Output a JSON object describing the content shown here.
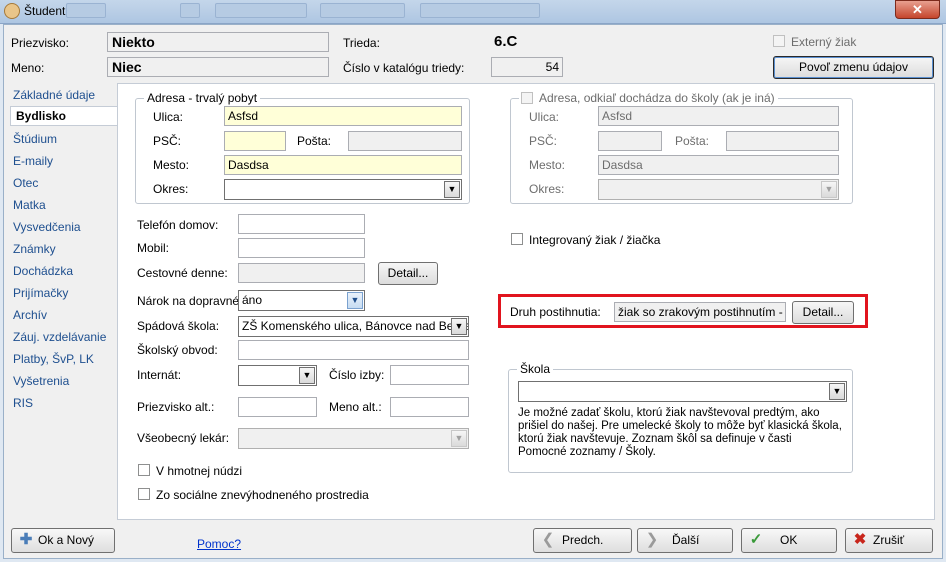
{
  "window": {
    "title": "Študent",
    "close_glyph": "✕"
  },
  "header": {
    "priezvisko_label": "Priezvisko:",
    "priezvisko_value": "Niekto",
    "meno_label": "Meno:",
    "meno_value": "Niec",
    "trieda_label": "Trieda:",
    "trieda_value": "6.C",
    "katalog_label": "Číslo v katalógu triedy:",
    "katalog_value": "54",
    "externy_label": "Externý žiak",
    "povol_button": "Povoľ zmenu údajov"
  },
  "nav": {
    "items": [
      "Základné údaje",
      "Bydlisko",
      "Štúdium",
      "E-maily",
      "Otec",
      "Matka",
      "Vysvedčenia",
      "Známky",
      "Dochádzka",
      "Prijímačky",
      "Archív",
      "Záuj. vzdelávanie",
      "Platby, ŠvP, LK",
      "Vyšetrenia",
      "RIS"
    ],
    "active": "Bydlisko"
  },
  "adresa": {
    "legend": "Adresa - trvalý pobyt",
    "ulica_label": "Ulica:",
    "ulica_value": "Asfsd",
    "psc_label": "PSČ:",
    "psc_value": "",
    "posta_label": "Pošta:",
    "posta_value": "",
    "mesto_label": "Mesto:",
    "mesto_value": "Dasdsa",
    "okres_label": "Okres:",
    "okres_value": ""
  },
  "adresa2": {
    "legend": "Adresa, odkiaľ dochádza do školy (ak je iná)",
    "ulica_label": "Ulica:",
    "ulica_value": "Asfsd",
    "psc_label": "PSČ:",
    "psc_value": "",
    "posta_label": "Pošta:",
    "posta_value": "",
    "mesto_label": "Mesto:",
    "mesto_value": "Dasdsa",
    "okres_label": "Okres:",
    "okres_value": ""
  },
  "contacts": {
    "telefon_label": "Telefón domov:",
    "telefon_value": "",
    "mobil_label": "Mobil:",
    "mobil_value": "",
    "cestovne_label": "Cestovné denne:",
    "cestovne_value": "",
    "detail_button": "Detail...",
    "narok_label": "Nárok na dopravné:",
    "narok_value": "áno",
    "spadova_label": "Spádová škola:",
    "spadova_value": "ZŠ Komenského ulica, Bánovce nad Bebravou",
    "obvod_label": "Školský obvod:",
    "obvod_value": "",
    "internat_label": "Internát:",
    "internat_value": "",
    "izba_label": "Číslo izby:",
    "izba_value": "",
    "priezvisko_alt_label": "Priezvisko alt.:",
    "priezvisko_alt_value": "",
    "meno_alt_label": "Meno alt.:",
    "meno_alt_value": "",
    "lekar_label": "Všeobecný lekár:",
    "lekar_value": "",
    "hmotna_label": "V hmotnej núdzi",
    "znevyhodnene_label": "Zo sociálne znevýhodneného prostredia"
  },
  "right": {
    "integrovany_label": "Integrovaný žiak / žiačka",
    "postihnutie_label": "Druh postihnutia:",
    "postihnutie_value": "žiak so zrakovým postihnutím - nevidiaci",
    "detail_button": "Detail...",
    "skola_legend": "Škola",
    "skola_value": "",
    "skola_info": "Je možné zadať školu, ktorú žiak navštevoval predtým, ako prišiel do našej. Pre umelecké školy to môže byť klasická škola, ktorú žiak navštevuje. Zoznam škôl sa definuje v časti Pomocné zoznamy / Školy."
  },
  "footer": {
    "ok_novy": "Ok a Nový",
    "pomoc": "Pomoc?",
    "predch": "Predch.",
    "dalsi": "Ďalší",
    "ok": "OK",
    "zrusit": "Zrušiť"
  },
  "colors": {
    "highlight": "#e1141e",
    "link": "#0033cc",
    "nav_text": "#1e4f8f"
  }
}
